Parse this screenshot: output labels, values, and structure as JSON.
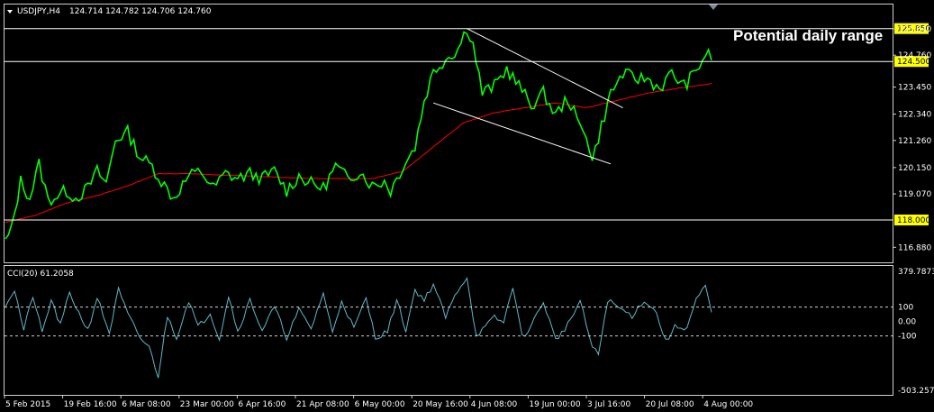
{
  "chart_data": {
    "type": "line",
    "symbol": "USDJPY,H4",
    "ohlc_header": "124.714 124.782 124.706 124.760",
    "x_labels": [
      "5 Feb 2015",
      "19 Feb 16:00",
      "6 Mar 08:00",
      "23 Mar 00:00",
      "6 Apr 16:00",
      "21 Apr 08:00",
      "6 May 00:00",
      "20 May 16:00",
      "4 Jun 08:00",
      "19 Jun 00:00",
      "3 Jul 16:00",
      "20 Jul 08:00",
      "4 Aug 00:00"
    ],
    "price_axis": {
      "ylim": [
        116.3,
        126.8
      ],
      "ticks": [
        "125.840",
        "124.760",
        "123.450",
        "122.340",
        "121.260",
        "120.150",
        "119.070",
        "116.880"
      ],
      "highlighted": [
        {
          "value": 125.85,
          "label": "125.850",
          "color": "#ffff00"
        },
        {
          "value": 124.5,
          "label": "124.500",
          "color": "#ffff00"
        },
        {
          "value": 118.0,
          "label": "118.000",
          "color": "#ffff00"
        }
      ]
    },
    "price_series": {
      "name": "",
      "color": "#00ff00",
      "keypoints": [
        [
          0,
          117.1
        ],
        [
          2,
          117.6
        ],
        [
          5,
          119.6
        ],
        [
          8,
          118.9
        ],
        [
          11,
          120.3
        ],
        [
          14,
          118.8
        ],
        [
          17,
          119.0
        ],
        [
          20,
          119.2
        ],
        [
          23,
          118.9
        ],
        [
          27,
          119.3
        ],
        [
          30,
          120.0
        ],
        [
          33,
          119.5
        ],
        [
          36,
          121.3
        ],
        [
          40,
          121.6
        ],
        [
          44,
          120.6
        ],
        [
          48,
          120.2
        ],
        [
          51,
          119.6
        ],
        [
          55,
          118.9
        ],
        [
          60,
          119.8
        ],
        [
          64,
          120.0
        ],
        [
          68,
          119.3
        ],
        [
          72,
          119.9
        ],
        [
          76,
          119.7
        ],
        [
          80,
          119.9
        ],
        [
          84,
          119.7
        ],
        [
          88,
          120.0
        ],
        [
          92,
          119.2
        ],
        [
          96,
          119.8
        ],
        [
          100,
          119.5
        ],
        [
          104,
          119.3
        ],
        [
          108,
          120.2
        ],
        [
          112,
          119.7
        ],
        [
          116,
          120.0
        ],
        [
          120,
          119.4
        ],
        [
          124,
          119.6
        ],
        [
          126,
          119.2
        ],
        [
          130,
          120.2
        ],
        [
          134,
          121.0
        ],
        [
          137,
          122.9
        ],
        [
          140,
          124.1
        ],
        [
          144,
          124.6
        ],
        [
          148,
          125.0
        ],
        [
          151,
          125.9
        ],
        [
          153,
          125.2
        ],
        [
          156,
          123.2
        ],
        [
          160,
          123.5
        ],
        [
          164,
          124.2
        ],
        [
          168,
          123.5
        ],
        [
          172,
          122.7
        ],
        [
          176,
          123.2
        ],
        [
          180,
          122.3
        ],
        [
          184,
          123.0
        ],
        [
          188,
          121.8
        ],
        [
          190,
          121.6
        ],
        [
          192,
          120.4
        ],
        [
          194,
          121.4
        ],
        [
          198,
          123.2
        ],
        [
          202,
          124.0
        ],
        [
          206,
          123.8
        ],
        [
          210,
          123.8
        ],
        [
          214,
          123.4
        ],
        [
          218,
          124.0
        ],
        [
          222,
          123.5
        ],
        [
          226,
          124.1
        ],
        [
          229,
          124.8
        ],
        [
          231,
          124.7
        ]
      ],
      "samples": 232
    },
    "moving_average": {
      "color": "#ff0000",
      "keypoints": [
        [
          0,
          117.9
        ],
        [
          10,
          118.2
        ],
        [
          20,
          118.7
        ],
        [
          30,
          119.0
        ],
        [
          40,
          119.4
        ],
        [
          50,
          119.9
        ],
        [
          60,
          119.9
        ],
        [
          80,
          119.8
        ],
        [
          100,
          119.7
        ],
        [
          120,
          119.7
        ],
        [
          130,
          120.0
        ],
        [
          140,
          121.0
        ],
        [
          150,
          122.0
        ],
        [
          160,
          122.4
        ],
        [
          170,
          122.6
        ],
        [
          180,
          122.8
        ],
        [
          190,
          122.6
        ],
        [
          200,
          122.9
        ],
        [
          210,
          123.2
        ],
        [
          220,
          123.4
        ],
        [
          231,
          123.6
        ]
      ]
    },
    "trend_lines": [
      {
        "from": [
          151,
          125.85
        ],
        "to": [
          202,
          122.6
        ],
        "color": "#ffffff"
      },
      {
        "from": [
          140,
          122.8
        ],
        "to": [
          198,
          120.3
        ],
        "color": "#ffffff"
      }
    ],
    "horizontal_lines": [
      {
        "value": 125.85,
        "color": "#ffffff"
      },
      {
        "value": 124.5,
        "color": "#ffffff"
      },
      {
        "value": 118.0,
        "color": "#ffffff"
      }
    ],
    "annotation": "Potential daily range",
    "indicator": {
      "label": "CCI(20) 61.2058",
      "color": "#5fb8c8",
      "ylim": [
        -503.2579,
        379.7873
      ],
      "ticks": [
        "379.7873",
        "100",
        "0.00",
        "-100",
        "-503.2579"
      ],
      "levels": [
        100,
        -100
      ],
      "keypoints": [
        [
          0,
          120
        ],
        [
          3,
          220
        ],
        [
          6,
          -60
        ],
        [
          9,
          180
        ],
        [
          12,
          -80
        ],
        [
          15,
          150
        ],
        [
          18,
          -30
        ],
        [
          21,
          200
        ],
        [
          24,
          60
        ],
        [
          27,
          -60
        ],
        [
          30,
          170
        ],
        [
          34,
          -80
        ],
        [
          37,
          220
        ],
        [
          40,
          50
        ],
        [
          44,
          -110
        ],
        [
          47,
          -180
        ],
        [
          50,
          -380
        ],
        [
          53,
          40
        ],
        [
          56,
          -110
        ],
        [
          60,
          150
        ],
        [
          63,
          -40
        ],
        [
          67,
          60
        ],
        [
          70,
          -120
        ],
        [
          73,
          180
        ],
        [
          76,
          -70
        ],
        [
          80,
          150
        ],
        [
          84,
          -60
        ],
        [
          88,
          100
        ],
        [
          92,
          -110
        ],
        [
          96,
          80
        ],
        [
          100,
          -50
        ],
        [
          104,
          200
        ],
        [
          107,
          -80
        ],
        [
          110,
          150
        ],
        [
          114,
          -50
        ],
        [
          118,
          160
        ],
        [
          121,
          -110
        ],
        [
          125,
          -70
        ],
        [
          128,
          150
        ],
        [
          131,
          -60
        ],
        [
          134,
          220
        ],
        [
          137,
          150
        ],
        [
          140,
          260
        ],
        [
          144,
          30
        ],
        [
          148,
          220
        ],
        [
          151,
          310
        ],
        [
          154,
          -100
        ],
        [
          157,
          -40
        ],
        [
          160,
          30
        ],
        [
          163,
          -10
        ],
        [
          166,
          250
        ],
        [
          169,
          -110
        ],
        [
          172,
          -30
        ],
        [
          176,
          140
        ],
        [
          180,
          -130
        ],
        [
          184,
          -20
        ],
        [
          188,
          140
        ],
        [
          192,
          -180
        ],
        [
          194,
          -230
        ],
        [
          197,
          150
        ],
        [
          201,
          90
        ],
        [
          205,
          40
        ],
        [
          209,
          150
        ],
        [
          213,
          60
        ],
        [
          216,
          -140
        ],
        [
          219,
          -40
        ],
        [
          223,
          -40
        ],
        [
          226,
          150
        ],
        [
          229,
          240
        ],
        [
          231,
          61
        ]
      ]
    }
  }
}
